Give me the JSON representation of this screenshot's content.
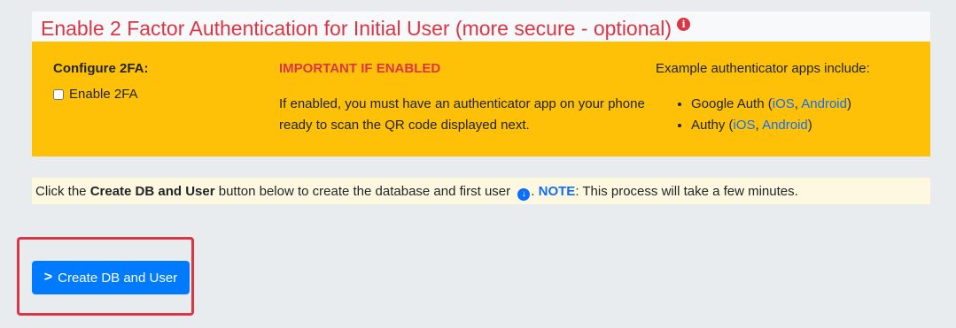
{
  "header": {
    "title": "Enable 2 Factor Authentication for Initial User (more secure - optional)",
    "info_icon": "i"
  },
  "twofa": {
    "configure_title": "Configure 2FA:",
    "checkbox_label": "Enable 2FA",
    "checkbox_checked": false,
    "important_title": "IMPORTANT IF ENABLED",
    "important_body": "If enabled, you must have an authenticator app on your phone ready to scan the QR code displayed next.",
    "apps_title": "Example authenticator apps include:",
    "apps": [
      {
        "name": "Google Auth",
        "ios": "iOS",
        "android": "Android"
      },
      {
        "name": "Authy",
        "ios": "iOS",
        "android": "Android"
      }
    ]
  },
  "note": {
    "prefix": "Click the ",
    "button_name": "Create DB and User",
    "middle": " button below to create the database and first user ",
    "note_label": "NOTE",
    "suffix": ": This process will take a few minutes."
  },
  "button": {
    "label": "Create DB and User",
    "chevron": ">"
  },
  "colors": {
    "header_red": "#dc3545",
    "panel_yellow": "#ffc107",
    "button_blue": "#007bff",
    "link_blue": "#0d6efd"
  }
}
